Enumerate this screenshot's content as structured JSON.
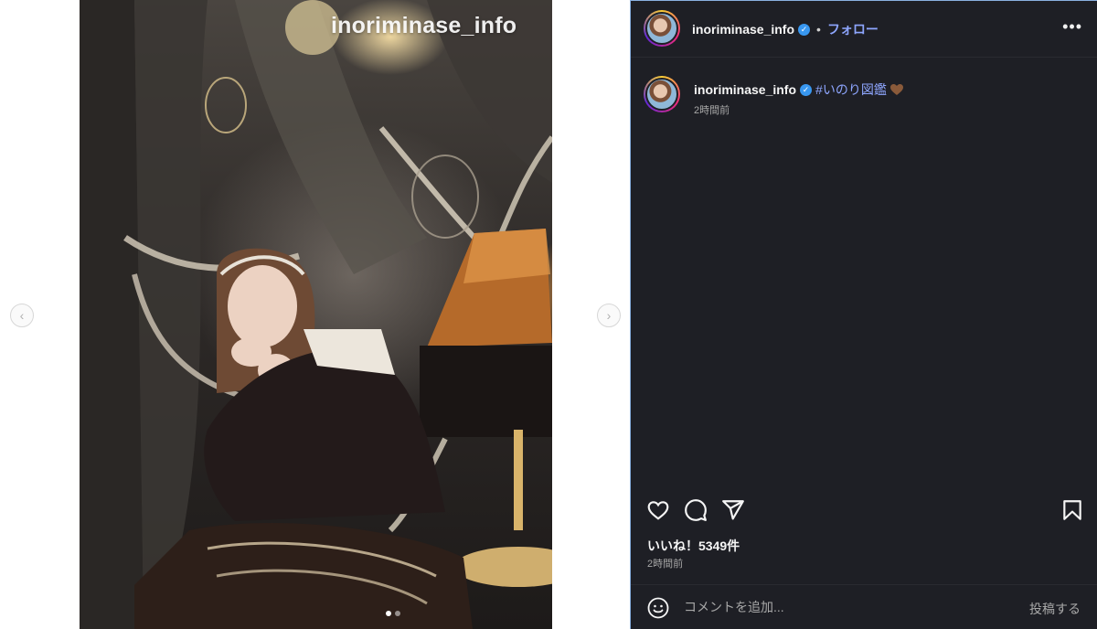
{
  "media": {
    "watermark": "inoriminase_info",
    "prev_icon": "chevron-left-icon",
    "next_icon": "chevron-right-icon",
    "carousel_dots": 2,
    "active_dot": 1
  },
  "header": {
    "username": "inoriminase_info",
    "separator": "•",
    "follow_label": "フォロー",
    "more_icon": "more-horizontal-icon"
  },
  "caption": {
    "username": "inoriminase_info",
    "hashtag": "#いのり図鑑",
    "emoji": "brown-heart",
    "time": "2時間前"
  },
  "actions": {
    "like_icon": "heart-icon",
    "comment_icon": "comment-icon",
    "share_icon": "share-icon",
    "save_icon": "bookmark-icon"
  },
  "likes": "いいね！5349件",
  "post_time": "2時間前",
  "comment": {
    "placeholder": "コメントを追加...",
    "post_label": "投稿する"
  },
  "colors": {
    "panel_bg": "#1e1f25",
    "accent": "#8ea6ff",
    "verified": "#3897f0"
  }
}
